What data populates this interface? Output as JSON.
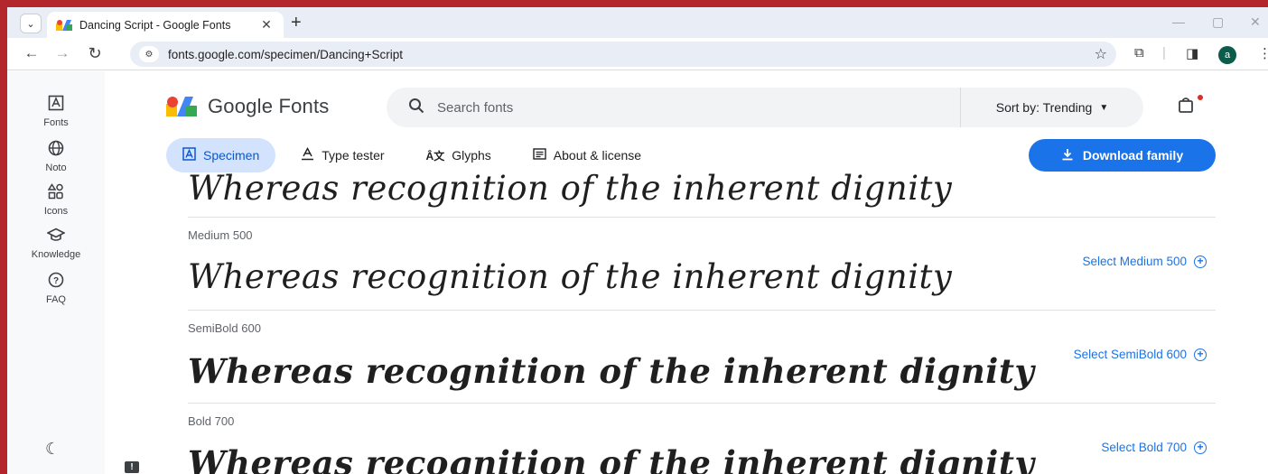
{
  "browser": {
    "tab_title": "Dancing Script - Google Fonts",
    "tab_close": "✕",
    "new_tab": "+",
    "url": "fonts.google.com/specimen/Dancing+Script",
    "profile_initial": "a"
  },
  "rail": {
    "items": [
      {
        "icon": "fonts-icon",
        "label": "Fonts"
      },
      {
        "icon": "globe-icon",
        "label": "Noto"
      },
      {
        "icon": "shapes-icon",
        "label": "Icons"
      },
      {
        "icon": "school-icon",
        "label": "Knowledge"
      },
      {
        "icon": "help-icon",
        "label": "FAQ"
      }
    ]
  },
  "header": {
    "logo_text": "Google Fonts",
    "search_placeholder": "Search fonts",
    "sort_label": "Sort by: Trending"
  },
  "tabs": [
    {
      "label": "Specimen",
      "icon": "specimen-icon",
      "active": true
    },
    {
      "label": "Type tester",
      "icon": "type-tester-icon",
      "active": false
    },
    {
      "label": "Glyphs",
      "icon": "glyphs-icon",
      "active": false
    },
    {
      "label": "About & license",
      "icon": "about-icon",
      "active": false
    }
  ],
  "download_label": "Download family",
  "sample_text": "Whereas recognition of the inherent dignity",
  "styles": [
    {
      "weight_label": "",
      "select_label": ""
    },
    {
      "weight_label": "Medium 500",
      "select_label": "Select Medium 500"
    },
    {
      "weight_label": "SemiBold 600",
      "select_label": "Select SemiBold 600"
    },
    {
      "weight_label": "Bold 700",
      "select_label": "Select Bold 700"
    }
  ],
  "colors": {
    "accent": "#1a73e8",
    "active_tab_bg": "#d3e3fd",
    "frame": "#b3262c"
  }
}
